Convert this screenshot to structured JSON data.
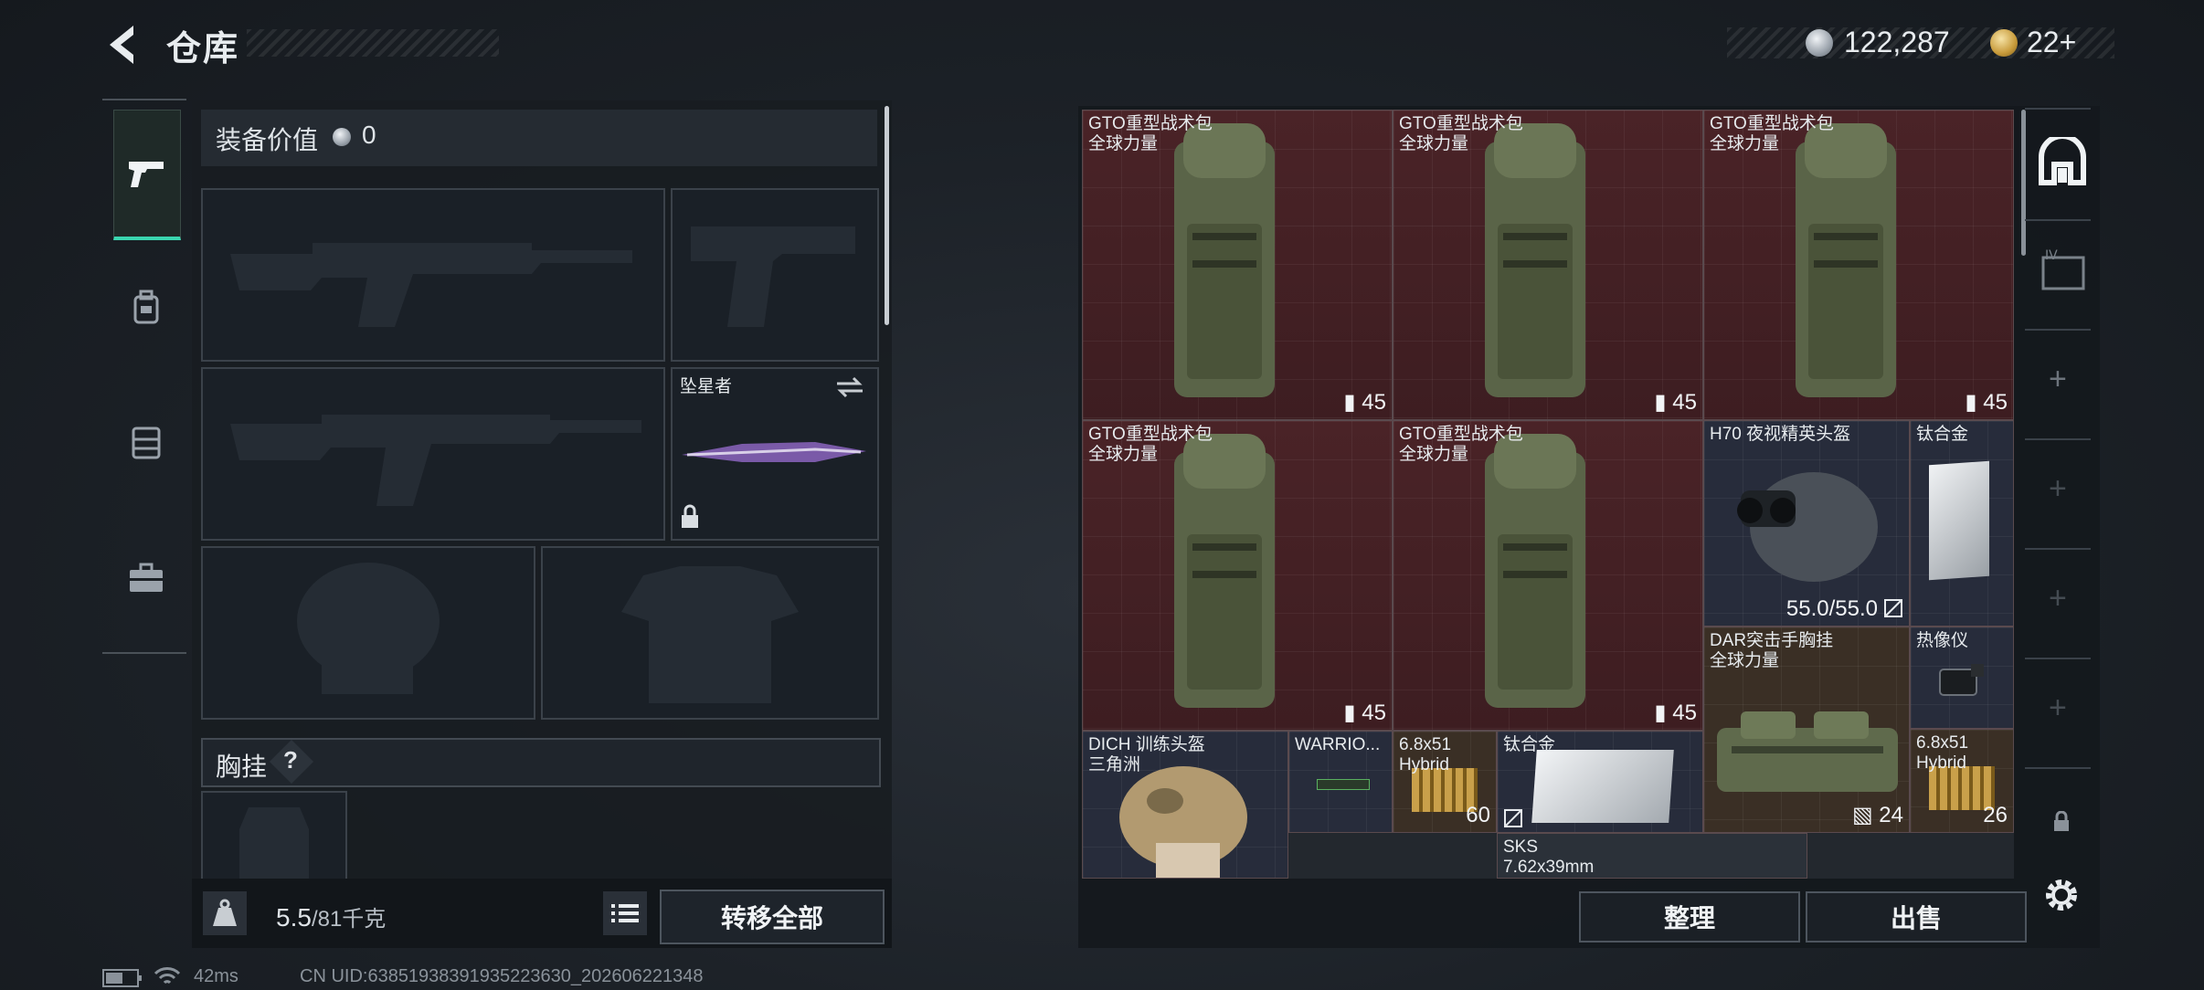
{
  "header": {
    "title": "仓库",
    "currency_main": "122,287",
    "currency_secondary": "22+"
  },
  "left": {
    "equipment_value_label": "装备价值",
    "equipment_value": "0",
    "melee_name": "坠星者",
    "section_label": "胸挂",
    "section_hint": "?",
    "weight_current": "5.5",
    "weight_max": "/81千克",
    "transfer_all": "转移全部"
  },
  "stash": {
    "items": [
      {
        "name": "GTO重型战术包",
        "sub": "全球力量",
        "count": "45"
      },
      {
        "name": "GTO重型战术包",
        "sub": "全球力量",
        "count": "45"
      },
      {
        "name": "GTO重型战术包",
        "sub": "全球力量",
        "count": "45"
      },
      {
        "name": "GTO重型战术包",
        "sub": "全球力量",
        "count": "45"
      },
      {
        "name": "GTO重型战术包",
        "sub": "全球力量",
        "count": "45"
      },
      {
        "name": "H70 夜视精英头盔",
        "durability": "55.0/55.0"
      },
      {
        "name": "钛合金"
      },
      {
        "name": "DAR突击手胸挂",
        "sub": "全球力量",
        "count": "24"
      },
      {
        "name": "热像仪"
      },
      {
        "name": "DICH 训练头盔",
        "sub": "三角洲"
      },
      {
        "name": "WARRIO..."
      },
      {
        "name": "6.8x51",
        "sub": "Hybrid",
        "count": "60"
      },
      {
        "name": "钛合金"
      },
      {
        "name": "6.8x51",
        "sub": "Hybrid",
        "count": "26"
      },
      {
        "name": "SKS",
        "sub": "7.62x39mm"
      }
    ],
    "organize": "整理",
    "sell": "出售"
  },
  "status": {
    "ping": "42ms",
    "uid": "CN UID:6385193839193522363​0_202606221348"
  },
  "colors": {
    "accent": "#3ad6b0",
    "rare_red": "#4a2327",
    "epic_navy": "#272c3b",
    "gold": "#c79a3a"
  }
}
